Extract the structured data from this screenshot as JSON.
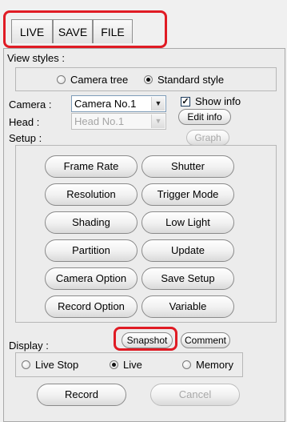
{
  "tabs": [
    "LIVE",
    "SAVE",
    "FILE"
  ],
  "view_styles": {
    "label": "View styles :",
    "options": [
      "Camera tree",
      "Standard style"
    ],
    "selected": "Standard style"
  },
  "camera": {
    "label": "Camera :",
    "value": "Camera No.1",
    "show_info_label": "Show info",
    "show_info_checked": true,
    "edit_info_label": "Edit info",
    "graph_label": "Graph"
  },
  "head": {
    "label": "Head :",
    "value": "Head No.1"
  },
  "setup": {
    "label": "Setup :",
    "buttons": [
      "Frame Rate",
      "Shutter",
      "Resolution",
      "Trigger Mode",
      "Shading",
      "Low Light",
      "Partition",
      "Update",
      "Camera Option",
      "Save Setup",
      "Record Option",
      "Variable"
    ]
  },
  "display": {
    "label": "Display :",
    "snapshot_label": "Snapshot",
    "comment_label": "Comment",
    "options": [
      "Live Stop",
      "Live",
      "Memory"
    ],
    "selected": "Live"
  },
  "record_label": "Record",
  "cancel_label": "Cancel",
  "highlight_color": "#e01b24"
}
